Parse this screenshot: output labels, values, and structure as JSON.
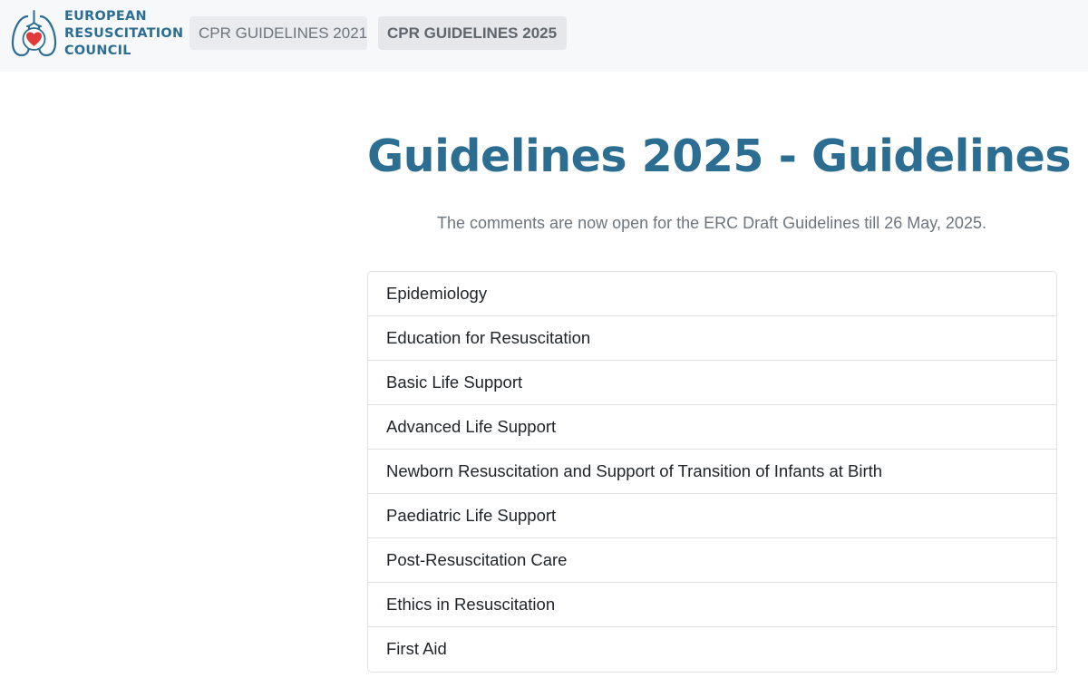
{
  "header": {
    "logo": {
      "lines": [
        "EUROPEAN",
        "RESUSCITATION",
        "COUNCIL"
      ],
      "icon": "heart-lungs-icon",
      "colors": {
        "brand": "#2c6e92",
        "heart": "#e03a3a"
      }
    },
    "nav": [
      {
        "label": "CPR GUIDELINES 2021",
        "active": false
      },
      {
        "label": "CPR GUIDELINES 2025",
        "active": true
      }
    ]
  },
  "main": {
    "title": "Guidelines 2025 - Guidelines",
    "subtitle": "The comments are now open for the ERC Draft Guidelines till 26 May, 2025.",
    "items": [
      "Epidemiology",
      "Education for Resuscitation",
      "Basic Life Support",
      "Advanced Life Support",
      "Newborn Resuscitation and Support of Transition of Infants at Birth",
      "Paediatric Life Support",
      "Post-Resuscitation Care",
      "Ethics in Resuscitation",
      "First Aid"
    ]
  }
}
